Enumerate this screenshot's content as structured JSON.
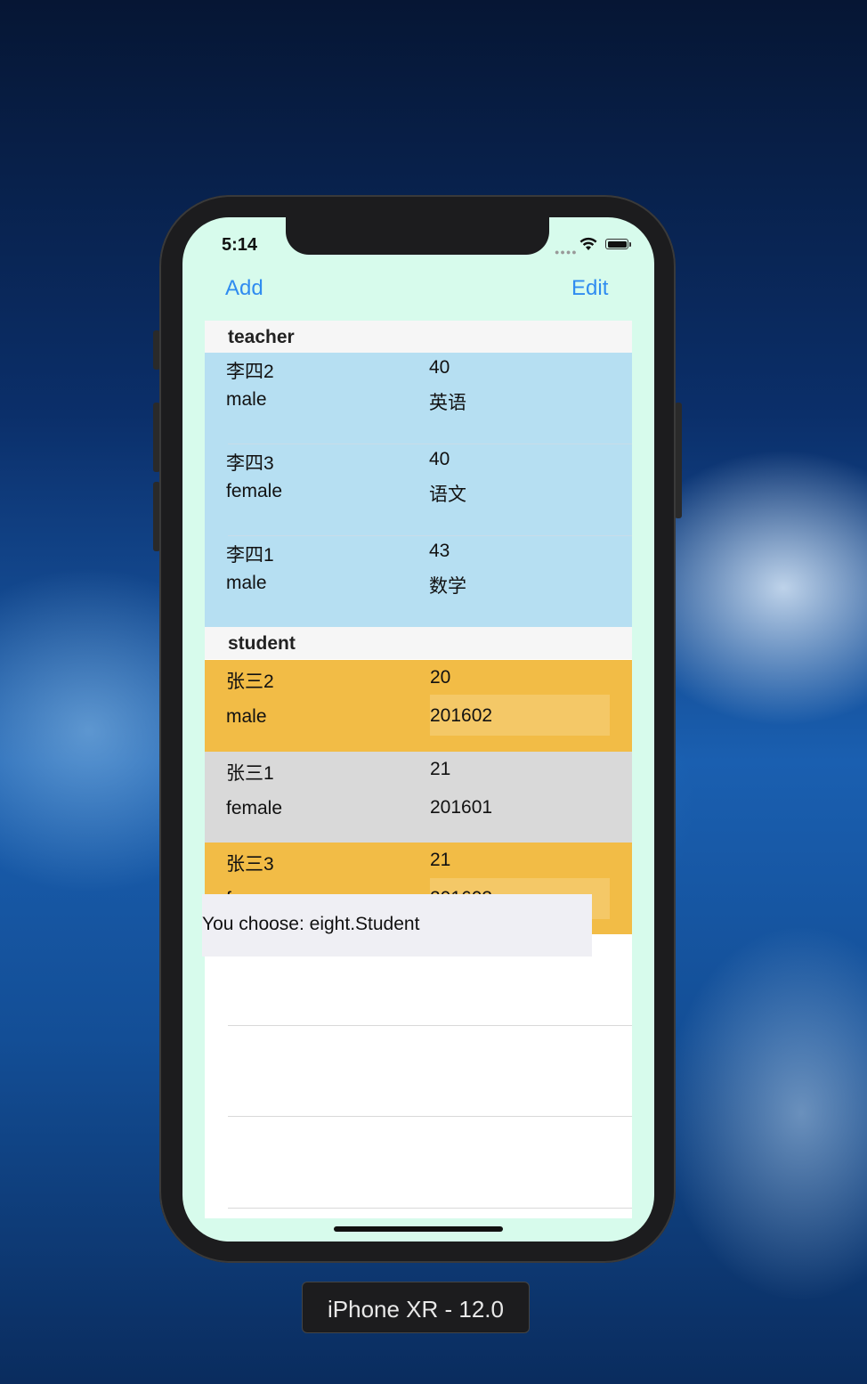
{
  "status_bar": {
    "time": "5:14"
  },
  "nav": {
    "add_label": "Add",
    "edit_label": "Edit"
  },
  "colors": {
    "accent": "#2f8cf0",
    "teacher_row": "#b6dff2",
    "student_row_highlight": "#f2bc46",
    "student_row_plain": "#d9d9d9",
    "screen_bg": "#d7fbec"
  },
  "sections": [
    {
      "title": "teacher",
      "rows": [
        {
          "name": "李四2",
          "age": "40",
          "gender": "male",
          "extra": "英语"
        },
        {
          "name": "李四3",
          "age": "40",
          "gender": "female",
          "extra": "语文"
        },
        {
          "name": "李四1",
          "age": "43",
          "gender": "male",
          "extra": "数学"
        }
      ]
    },
    {
      "title": "student",
      "rows": [
        {
          "name": "张三2",
          "age": "20",
          "gender": "male",
          "extra": "201602"
        },
        {
          "name": "张三1",
          "age": "21",
          "gender": "female",
          "extra": "201601"
        },
        {
          "name": "张三3",
          "age": "21",
          "gender": "f",
          "extra": "201603"
        }
      ]
    }
  ],
  "toast": {
    "message": "You choose: eight.Student"
  },
  "device_label": "iPhone XR - 12.0"
}
